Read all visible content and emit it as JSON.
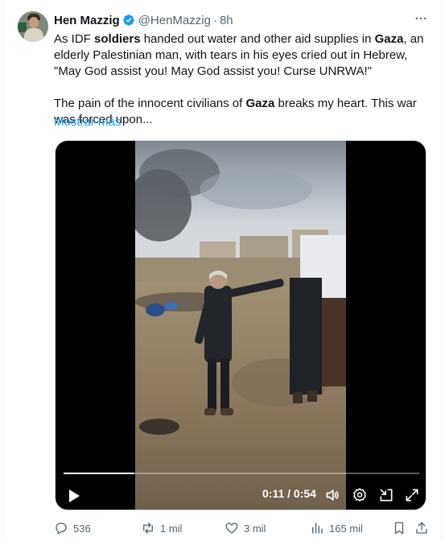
{
  "author": {
    "name": "Hen Mazzig",
    "handle": "@HenMazzig",
    "separator": "·",
    "time": "8h",
    "verified": true
  },
  "tweet": {
    "p1_a": "As IDF ",
    "p1_b": "soldiers",
    "p1_c": " handed out water and other aid supplies in ",
    "p1_d": "Gaza",
    "p1_e": ", an elderly Palestinian man, with tears in his eyes cried out in Hebrew, \"May God assist you! May God assist you! Curse UNRWA!\"",
    "p2_a": "The pain of the innocent civilians of ",
    "p2_b": "Gaza",
    "p2_c": " breaks my heart. This war was forced upon...",
    "show_more": "Mostrar más"
  },
  "video": {
    "current_time": "0:11",
    "time_separator": " / ",
    "duration": "0:54",
    "progress_fraction": 0.2
  },
  "actions": {
    "replies": "536",
    "reposts": "1 mil",
    "likes": "3 mil",
    "views": "165 mil"
  },
  "colors": {
    "accent": "#1d9bf0",
    "text": "#0f1419",
    "secondary": "#536471"
  },
  "icons": [
    "more-icon",
    "verified-badge-icon",
    "play-icon",
    "volume-icon",
    "settings-icon",
    "minimize-icon",
    "fullscreen-icon",
    "reply-icon",
    "repost-icon",
    "like-icon",
    "views-icon",
    "bookmark-icon",
    "share-icon"
  ]
}
